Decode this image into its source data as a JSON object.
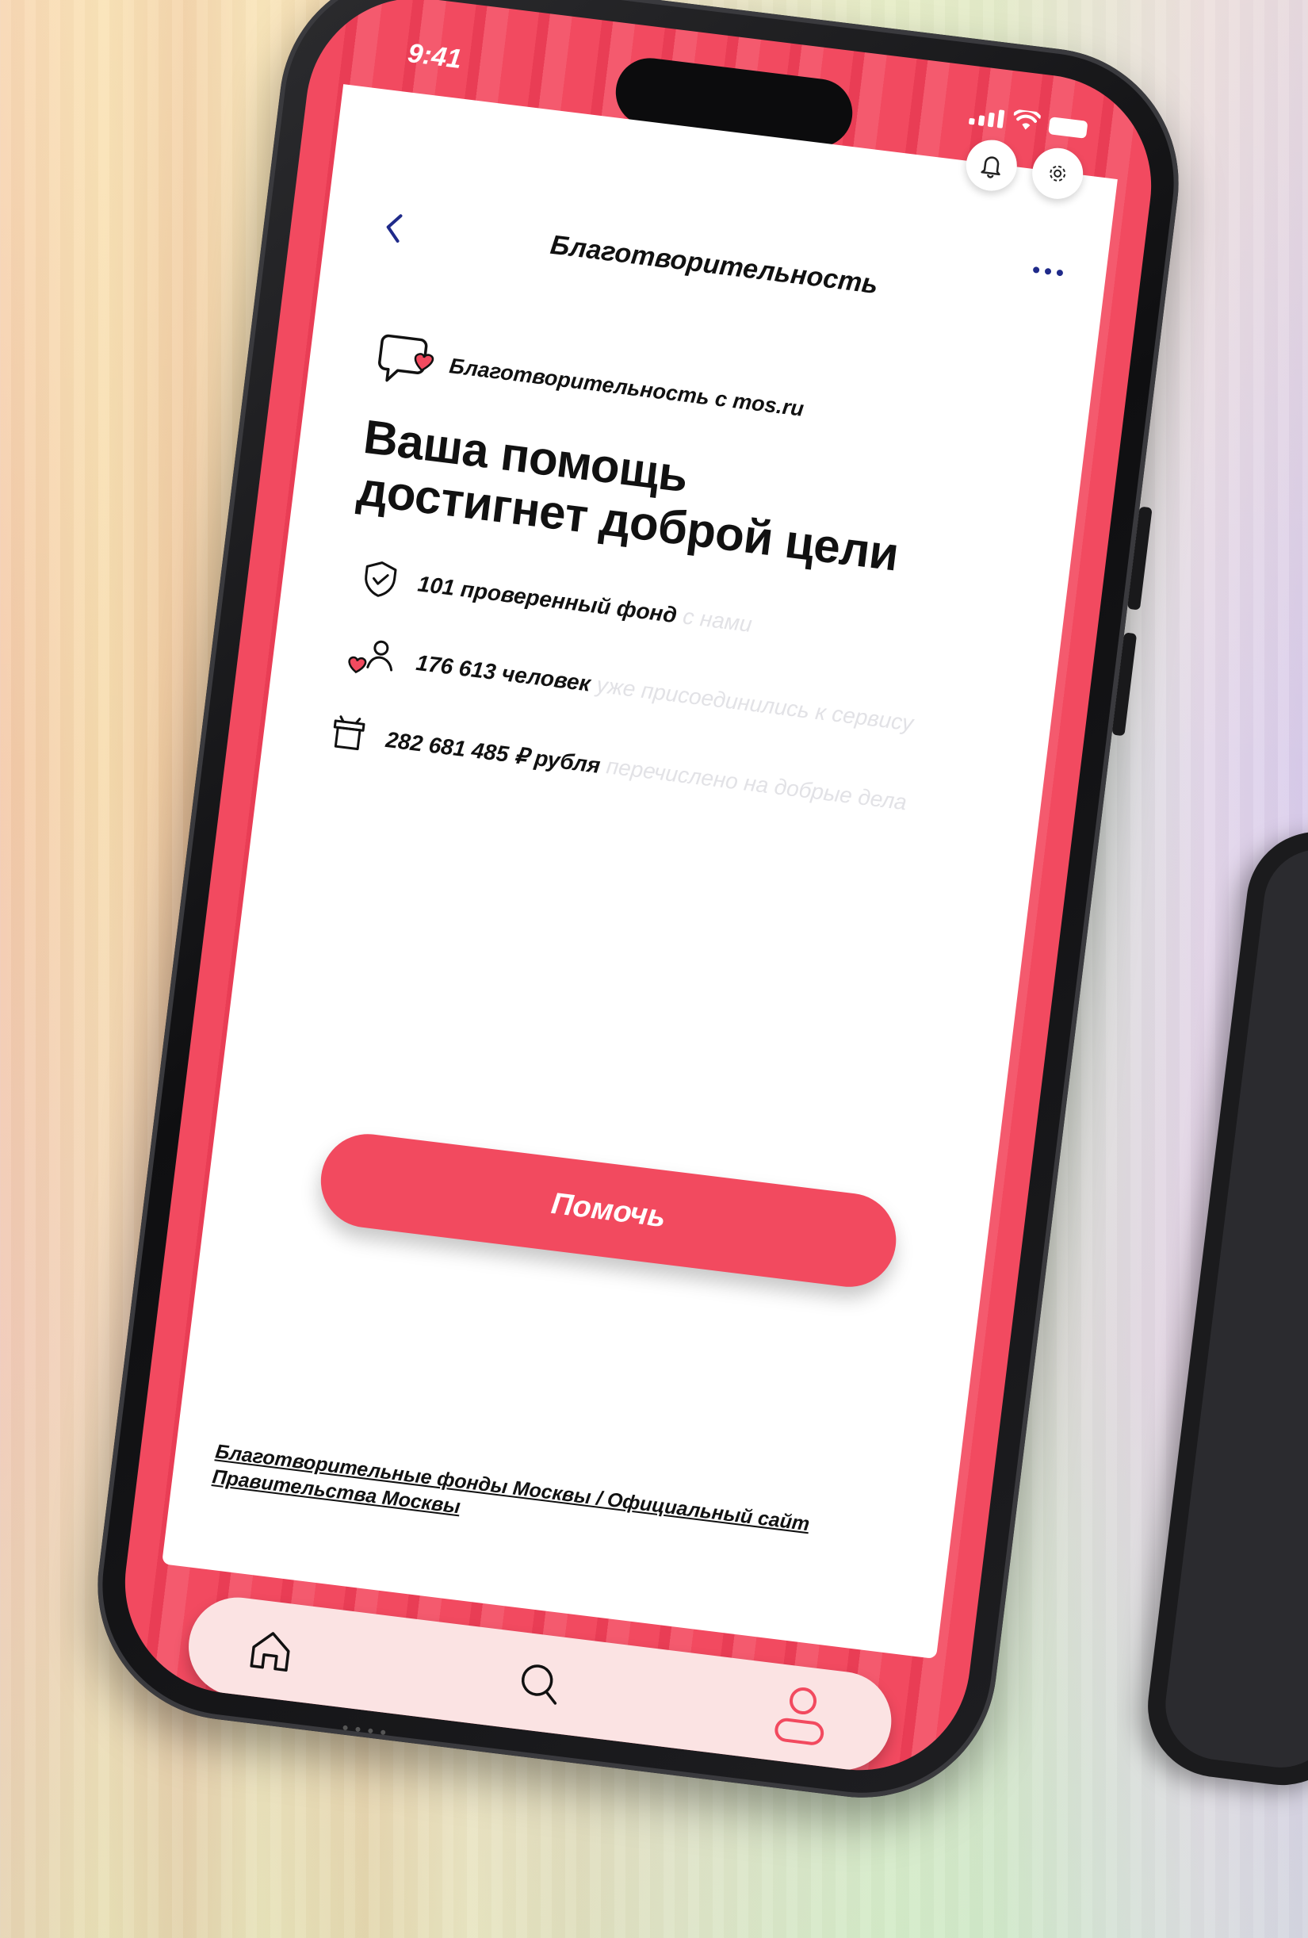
{
  "status": {
    "time": "9:41"
  },
  "header": {
    "title": "Благотворительность",
    "back_icon": "chevron-left-icon",
    "more_icon": "more-dots-icon",
    "notifications_icon": "bell-icon",
    "settings_icon": "gear-icon"
  },
  "brand": {
    "label": "Благотворительность с mos.ru",
    "icon": "chat-heart-icon"
  },
  "headline": {
    "line1": "Ваша помощь",
    "line2": "достигнет доброй цели"
  },
  "stats": [
    {
      "icon": "shield-check-icon",
      "strong": "101 проверенный фонд",
      "faint": "с нами"
    },
    {
      "icon": "heart-person-icon",
      "strong": "176 613 человек",
      "faint": "уже присоединились к сервису"
    },
    {
      "icon": "box-icon",
      "strong": "282 681 485 ₽ рубля",
      "faint": "перечислено на добрые дела"
    }
  ],
  "actions": {
    "help_label": "Помочь"
  },
  "footer": {
    "link_text": "Благотворительные фонды Москвы / Официальный сайт Правительства Москвы"
  },
  "tabbar": {
    "items": [
      {
        "name": "home",
        "icon": "home-icon"
      },
      {
        "name": "search",
        "icon": "search-icon"
      },
      {
        "name": "profile",
        "icon": "profile-icon"
      }
    ]
  },
  "colors": {
    "accent": "#f24a5f",
    "tabbar_bg": "#fbe3e3",
    "nav_blue": "#1f2a8a"
  }
}
